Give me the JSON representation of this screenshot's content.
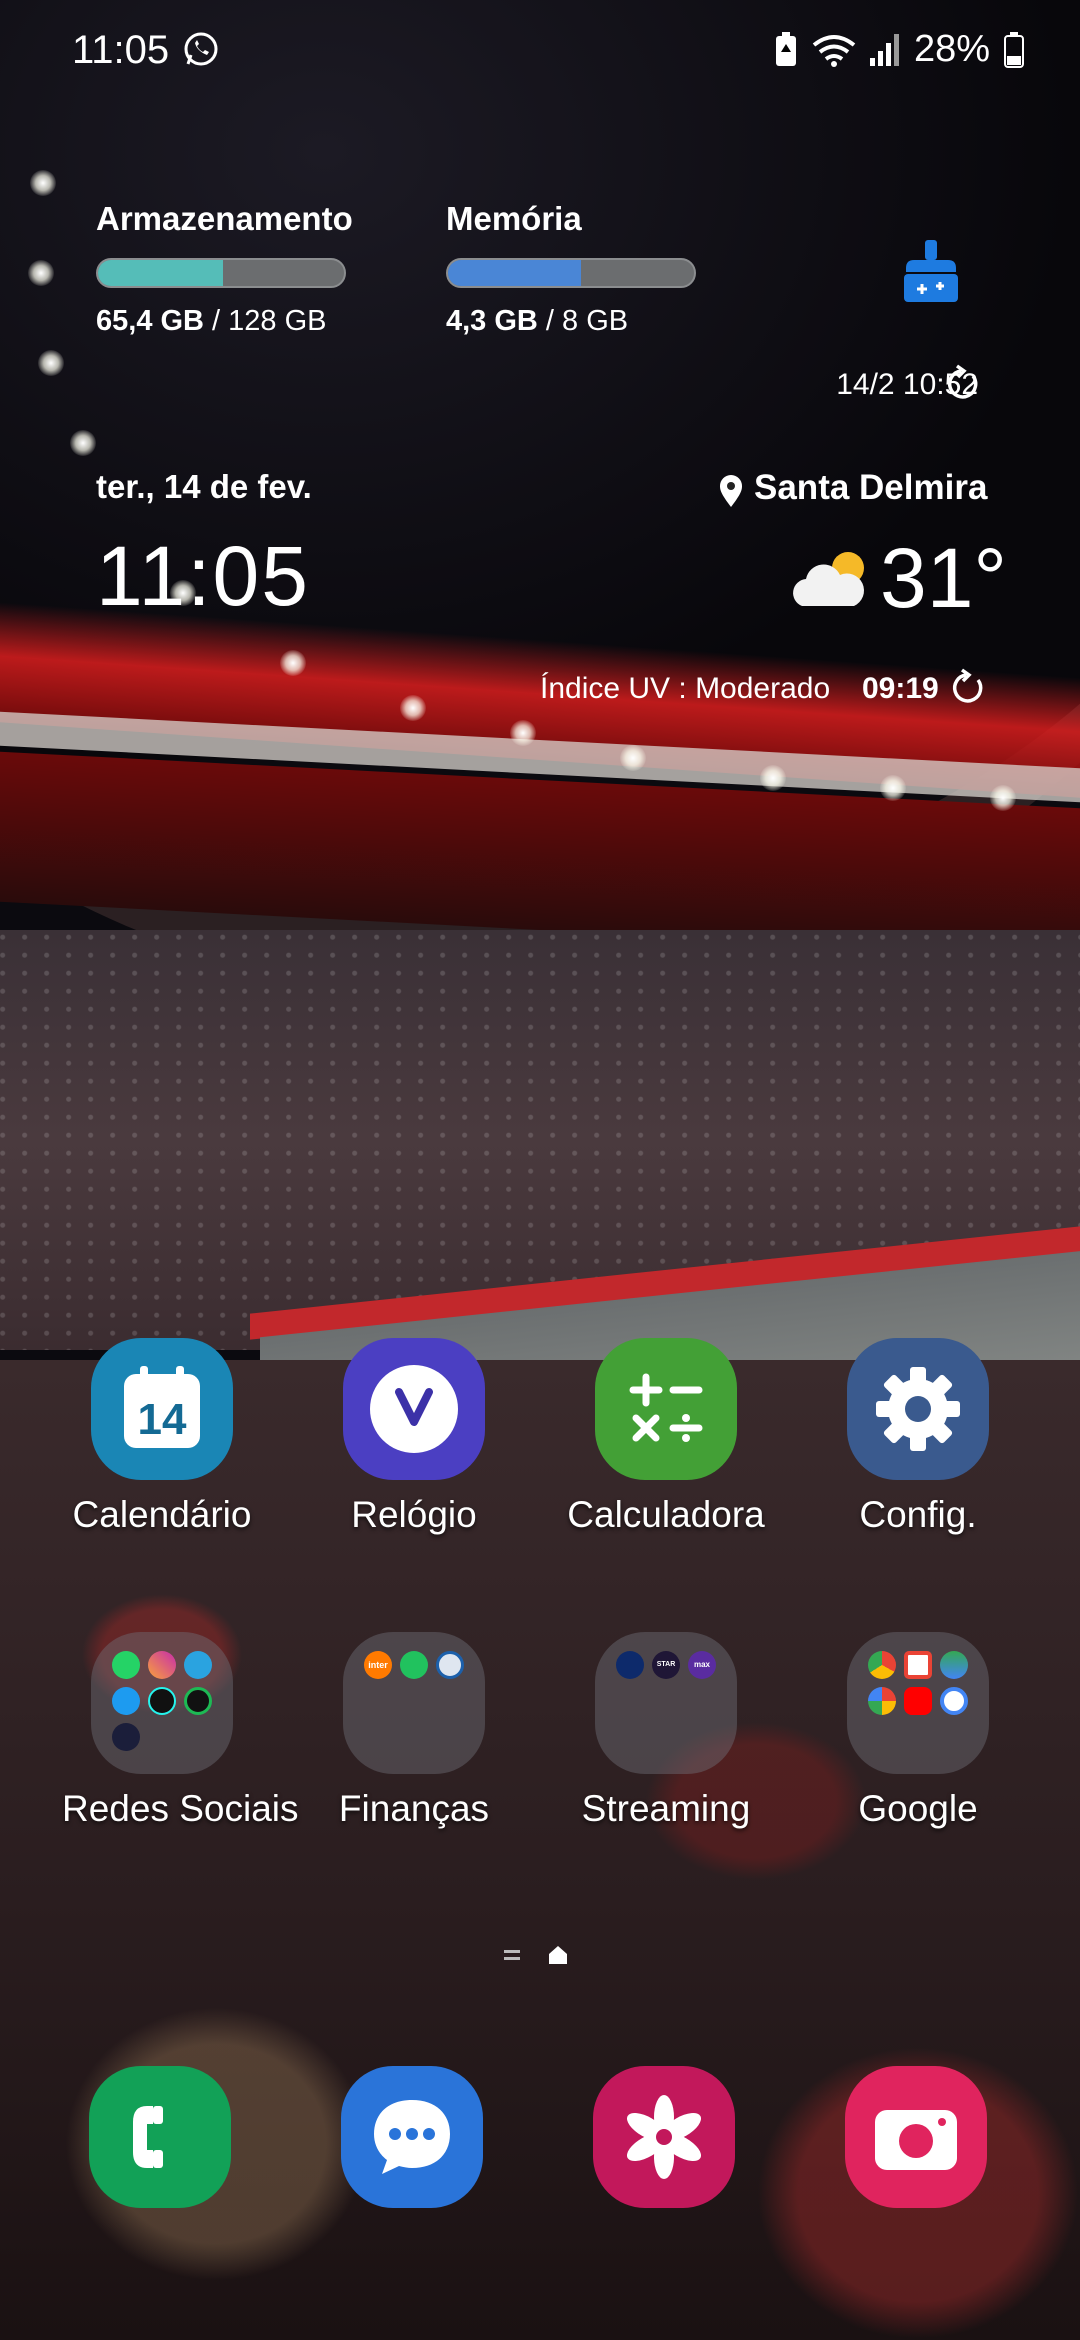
{
  "status_bar": {
    "time": "11:05",
    "battery_percent": "28%",
    "icons": [
      "whatsapp-icon",
      "battery-saver-icon",
      "wifi-icon",
      "signal-icon",
      "battery-icon"
    ]
  },
  "device_care": {
    "storage": {
      "label": "Armazenamento",
      "used": "65,4 GB",
      "total": " / 128 GB",
      "fraction": 0.51,
      "color": "#55bdb8"
    },
    "memory": {
      "label": "Memória",
      "used": "4,3 GB",
      "total": " / 8 GB",
      "fraction": 0.54,
      "color": "#4a86d6"
    },
    "updated": "14/2 10:52",
    "clean_icon": "broom-icon"
  },
  "clock": {
    "date": "ter., 14 de fev.",
    "time": "11:05"
  },
  "weather": {
    "location": "Santa Delmira",
    "temperature": "31°",
    "uv_index": "Índice UV : Moderado",
    "updated": "09:19",
    "icon": "partly-cloudy-icon"
  },
  "apps_row1": [
    {
      "label": "Calendário",
      "icon": "calendar-icon",
      "badge": "14",
      "color": "#1a86b5"
    },
    {
      "label": "Relógio",
      "icon": "clock-icon",
      "color": "#4b3fc2"
    },
    {
      "label": "Calculadora",
      "icon": "calculator-icon",
      "color": "#43a036"
    },
    {
      "label": "Config.",
      "icon": "settings-gear-icon",
      "color": "#3a5a8e"
    }
  ],
  "folders": [
    {
      "label": "Redes Sociais",
      "apps": [
        "whatsapp-icon",
        "instagram-icon",
        "telegram-icon",
        "twitter-icon",
        "tiktok-icon",
        "spotify-icon",
        "app-icon"
      ]
    },
    {
      "label": "Finanças",
      "apps": [
        "inter-icon",
        "picpay-icon",
        "caixa-icon"
      ]
    },
    {
      "label": "Streaming",
      "apps": [
        "disney-plus-icon",
        "star-plus-icon",
        "hbo-max-icon"
      ]
    },
    {
      "label": "Google",
      "apps": [
        "chrome-icon",
        "gmail-icon",
        "maps-icon",
        "photos-icon",
        "youtube-icon",
        "lens-icon"
      ]
    }
  ],
  "folder_mini_labels": {
    "inter": "inter",
    "hbo": "max",
    "star": "STAR"
  },
  "dock": [
    {
      "name": "phone",
      "icon": "phone-icon",
      "color": "#12a157"
    },
    {
      "name": "messages",
      "icon": "messages-icon",
      "color": "#2a74d9"
    },
    {
      "name": "gallery",
      "icon": "gallery-flower-icon",
      "color": "#c2185b"
    },
    {
      "name": "camera",
      "icon": "camera-icon",
      "color": "#e0245e"
    }
  ]
}
